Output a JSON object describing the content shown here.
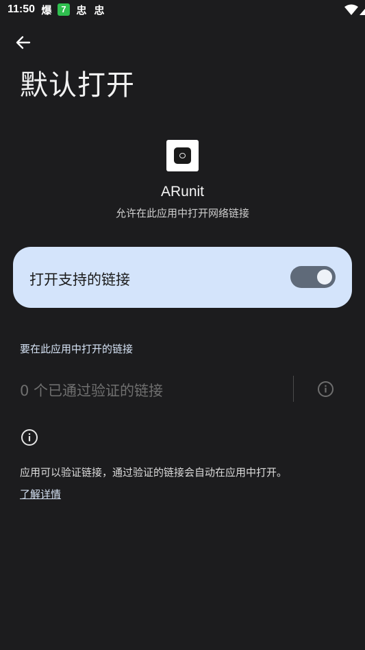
{
  "status_bar": {
    "time": "11:50",
    "notifications": [
      "爆",
      "7",
      "忠",
      "忠"
    ],
    "icons": [
      "wifi-icon",
      "signal-icon",
      "battery-icon"
    ]
  },
  "header": {
    "back_icon": "arrow-left-icon",
    "title": "默认打开"
  },
  "app": {
    "name": "ARunit",
    "subtitle": "允许在此应用中打开网络链接"
  },
  "toggle": {
    "label": "打开支持的链接",
    "enabled": true,
    "accent": "#d4e4fb"
  },
  "links_section": {
    "header": "要在此应用中打开的链接",
    "verified_text": "0 个已通过验证的链接",
    "info_icon": "info-icon"
  },
  "footer": {
    "info_icon": "info-icon",
    "description": "应用可以验证链接，通过验证的链接会自动在应用中打开。",
    "learn_more": "了解详情"
  }
}
